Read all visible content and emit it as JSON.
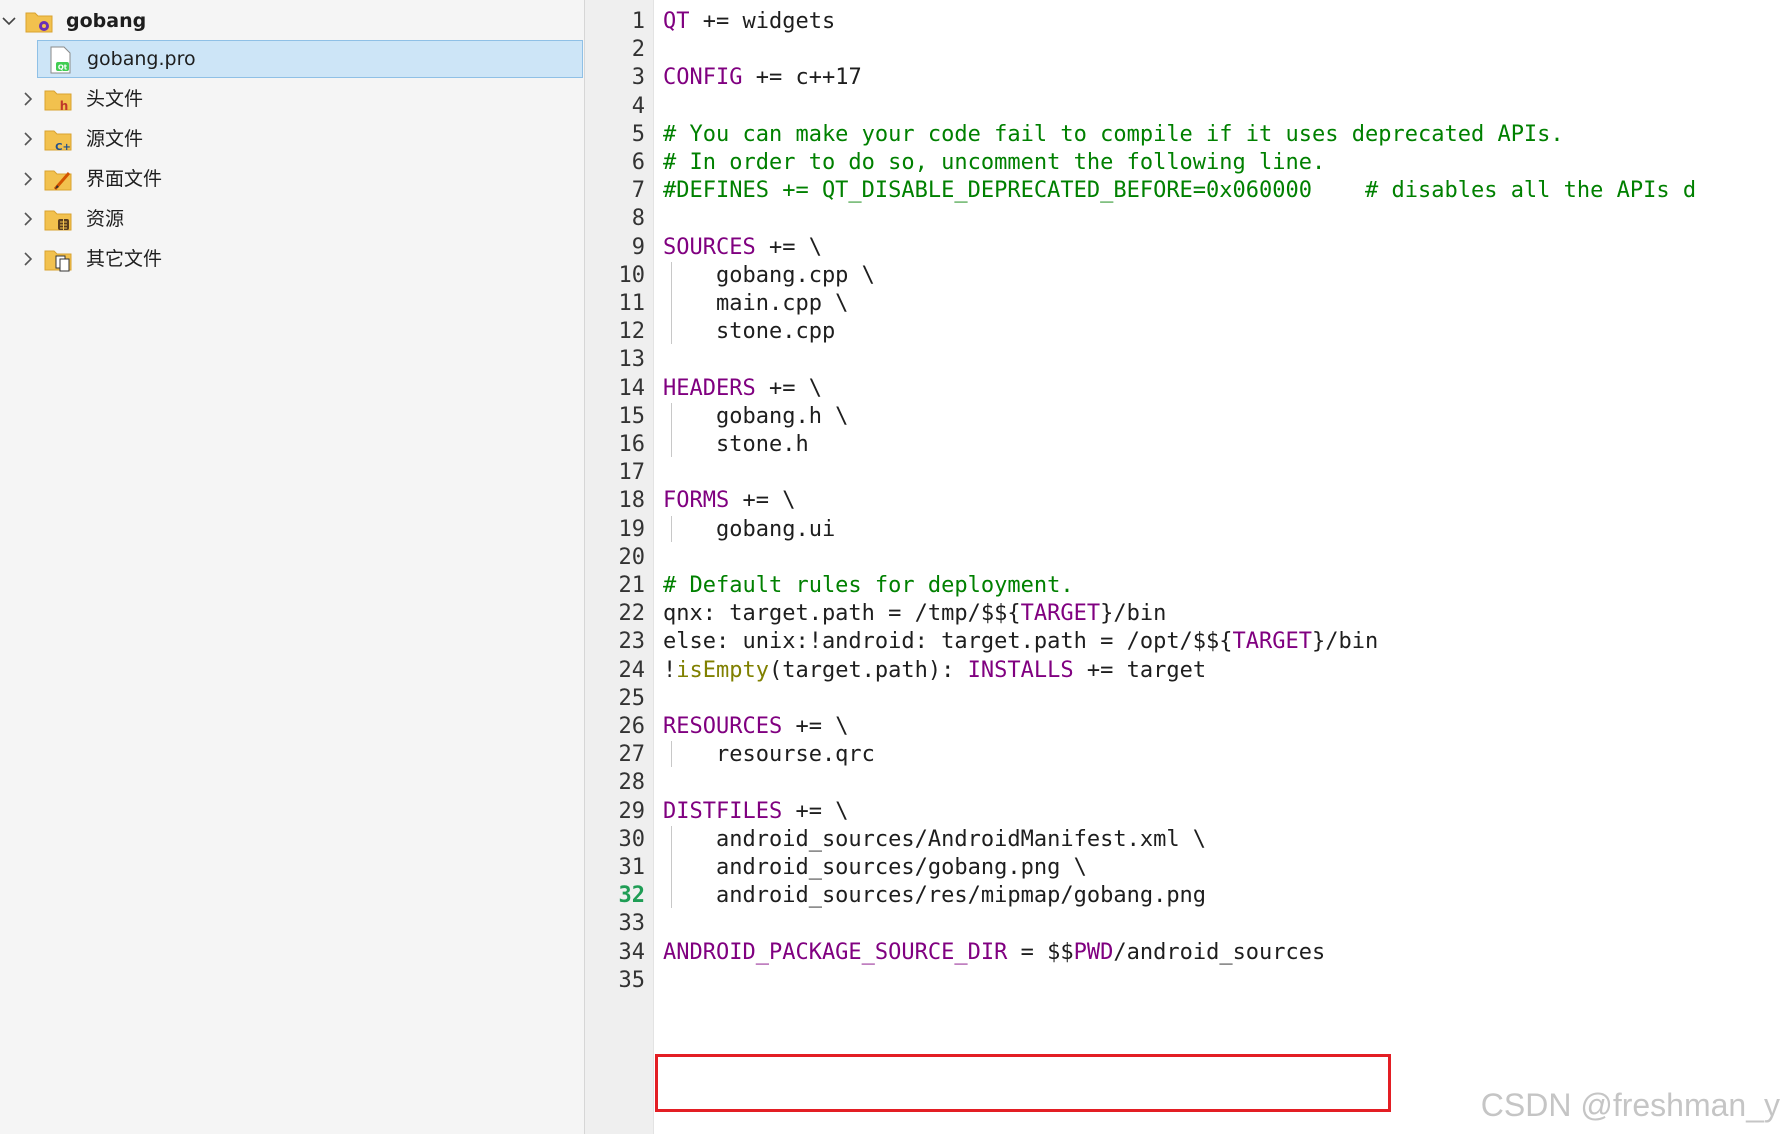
{
  "project_tree": {
    "root": {
      "label": "gobang",
      "icon": "qt-project-folder-icon",
      "expanded": true
    },
    "items": [
      {
        "label": "gobang.pro",
        "icon": "qt-pro-file-icon",
        "selected": true,
        "expandable": false
      },
      {
        "label": "头文件",
        "icon": "header-folder-icon",
        "expandable": true
      },
      {
        "label": "源文件",
        "icon": "cpp-source-folder-icon",
        "expandable": true
      },
      {
        "label": "界面文件",
        "icon": "form-folder-icon",
        "expandable": true
      },
      {
        "label": "资源",
        "icon": "resource-folder-icon",
        "expandable": true
      },
      {
        "label": "其它文件",
        "icon": "other-files-folder-icon",
        "expandable": true
      }
    ]
  },
  "editor": {
    "current_line": 32,
    "highlighted_line": 34,
    "lines": [
      {
        "n": "1",
        "tokens": [
          [
            "kw",
            "QT"
          ],
          [
            "plain",
            " += widgets"
          ]
        ]
      },
      {
        "n": "2",
        "tokens": []
      },
      {
        "n": "3",
        "tokens": [
          [
            "kw",
            "CONFIG"
          ],
          [
            "plain",
            " += c++17"
          ]
        ]
      },
      {
        "n": "4",
        "tokens": []
      },
      {
        "n": "5",
        "tokens": [
          [
            "comment",
            "# You can make your code fail to compile if it uses deprecated APIs."
          ]
        ]
      },
      {
        "n": "6",
        "tokens": [
          [
            "comment",
            "# In order to do so, uncomment the following line."
          ]
        ]
      },
      {
        "n": "7",
        "tokens": [
          [
            "comment",
            "#DEFINES += QT_DISABLE_DEPRECATED_BEFORE=0x060000    # disables all the APIs d"
          ]
        ]
      },
      {
        "n": "8",
        "tokens": []
      },
      {
        "n": "9",
        "tokens": [
          [
            "kw",
            "SOURCES"
          ],
          [
            "plain",
            " += \\"
          ]
        ]
      },
      {
        "n": "10",
        "tokens": [
          [
            "plain",
            "    gobang.cpp \\"
          ]
        ]
      },
      {
        "n": "11",
        "tokens": [
          [
            "plain",
            "    main.cpp \\"
          ]
        ]
      },
      {
        "n": "12",
        "tokens": [
          [
            "plain",
            "    stone.cpp"
          ]
        ]
      },
      {
        "n": "13",
        "tokens": []
      },
      {
        "n": "14",
        "tokens": [
          [
            "kw",
            "HEADERS"
          ],
          [
            "plain",
            " += \\"
          ]
        ]
      },
      {
        "n": "15",
        "tokens": [
          [
            "plain",
            "    gobang.h \\"
          ]
        ]
      },
      {
        "n": "16",
        "tokens": [
          [
            "plain",
            "    stone.h"
          ]
        ]
      },
      {
        "n": "17",
        "tokens": []
      },
      {
        "n": "18",
        "tokens": [
          [
            "kw",
            "FORMS"
          ],
          [
            "plain",
            " += \\"
          ]
        ]
      },
      {
        "n": "19",
        "tokens": [
          [
            "plain",
            "    gobang.ui"
          ]
        ]
      },
      {
        "n": "20",
        "tokens": []
      },
      {
        "n": "21",
        "tokens": [
          [
            "comment",
            "# Default rules for deployment."
          ]
        ]
      },
      {
        "n": "22",
        "tokens": [
          [
            "plain",
            "qnx: target.path = /tmp/$${"
          ],
          [
            "kw",
            "TARGET"
          ],
          [
            "plain",
            "}/bin"
          ]
        ]
      },
      {
        "n": "23",
        "tokens": [
          [
            "plain",
            "else: unix:!android: target.path = /opt/$${"
          ],
          [
            "kw",
            "TARGET"
          ],
          [
            "plain",
            "}/bin"
          ]
        ]
      },
      {
        "n": "24",
        "tokens": [
          [
            "plain",
            "!"
          ],
          [
            "fn",
            "isEmpty"
          ],
          [
            "plain",
            "(target.path): "
          ],
          [
            "kw",
            "INSTALLS"
          ],
          [
            "plain",
            " += target"
          ]
        ]
      },
      {
        "n": "25",
        "tokens": []
      },
      {
        "n": "26",
        "tokens": [
          [
            "kw",
            "RESOURCES"
          ],
          [
            "plain",
            " += \\"
          ]
        ]
      },
      {
        "n": "27",
        "tokens": [
          [
            "plain",
            "    resourse.qrc"
          ]
        ]
      },
      {
        "n": "28",
        "tokens": []
      },
      {
        "n": "29",
        "tokens": [
          [
            "kw",
            "DISTFILES"
          ],
          [
            "plain",
            " += \\"
          ]
        ]
      },
      {
        "n": "30",
        "tokens": [
          [
            "plain",
            "    android_sources/AndroidManifest.xml \\"
          ]
        ]
      },
      {
        "n": "31",
        "tokens": [
          [
            "plain",
            "    android_sources/gobang.png \\"
          ]
        ]
      },
      {
        "n": "32",
        "tokens": [
          [
            "plain",
            "    android_sources/res/mipmap/gobang.png"
          ]
        ]
      },
      {
        "n": "33",
        "tokens": []
      },
      {
        "n": "34",
        "tokens": [
          [
            "kw",
            "ANDROID_PACKAGE_SOURCE_DIR"
          ],
          [
            "plain",
            " = $$"
          ],
          [
            "kw",
            "PWD"
          ],
          [
            "plain",
            "/android_sources"
          ]
        ]
      },
      {
        "n": "35",
        "tokens": []
      }
    ]
  },
  "colors": {
    "keyword": "#800080",
    "comment": "#008000",
    "function": "#808000",
    "current_line_number": "#1f9d55",
    "highlight_box": "#e31e24",
    "selection_bg": "#cde5f7"
  },
  "watermark": "CSDN @freshman_y"
}
